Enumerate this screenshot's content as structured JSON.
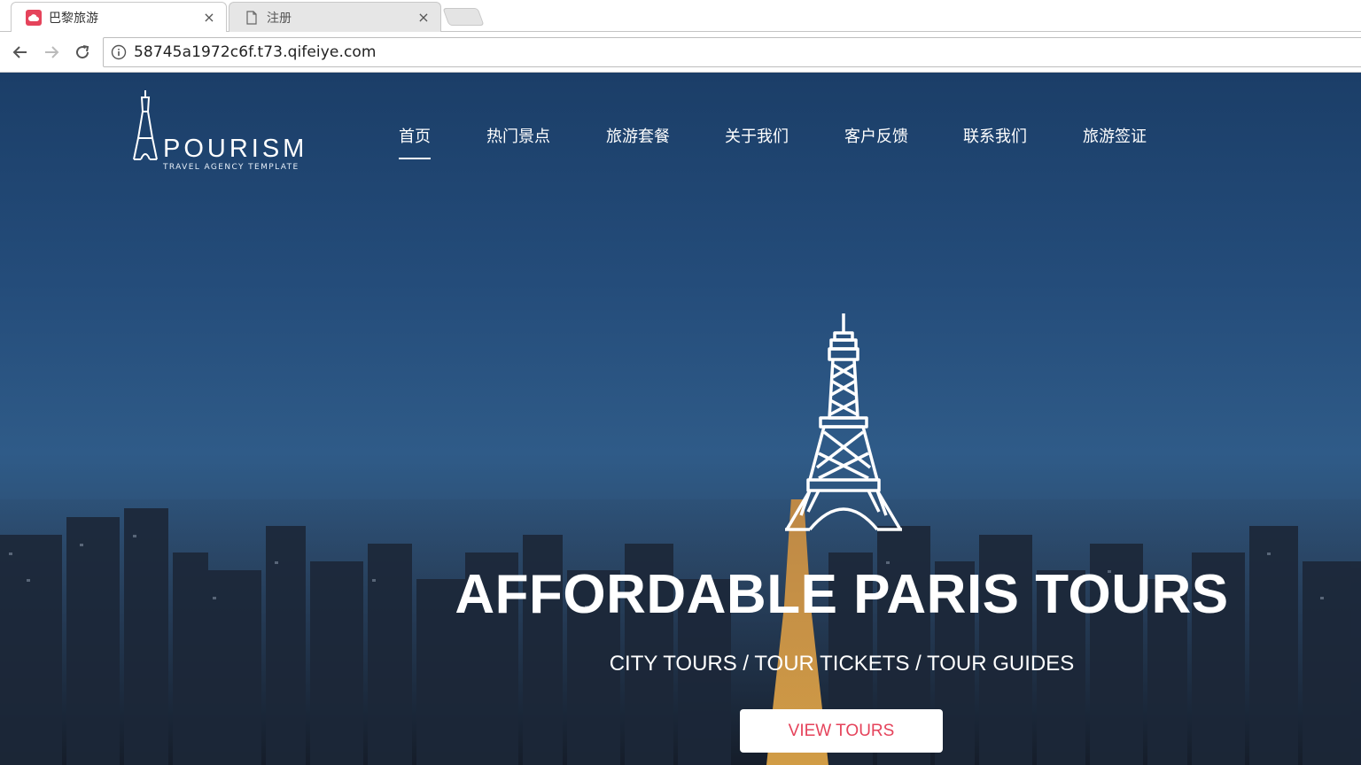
{
  "browser": {
    "tabs": [
      {
        "title": "巴黎旅游",
        "icon": "cloud-favicon-icon",
        "active": true
      },
      {
        "title": "注册",
        "icon": "page-icon",
        "active": false
      }
    ],
    "tab_close_glyph": "×",
    "url": "58745a1972c6f.t73.qifeiye.com"
  },
  "site": {
    "logo": {
      "name": "POURISM",
      "tagline": "TRAVEL AGENCY TEMPLATE"
    },
    "nav": [
      {
        "label": "首页",
        "active": true
      },
      {
        "label": "热门景点",
        "active": false
      },
      {
        "label": "旅游套餐",
        "active": false
      },
      {
        "label": "关于我们",
        "active": false
      },
      {
        "label": "客户反馈",
        "active": false
      },
      {
        "label": "联系我们",
        "active": false
      },
      {
        "label": "旅游签证",
        "active": false
      }
    ],
    "hero": {
      "headline": "AFFORDABLE PARIS TOURS",
      "subline": "CITY TOURS / TOUR TICKETS / TOUR GUIDES",
      "cta_label": "VIEW TOURS"
    }
  },
  "colors": {
    "accent": "#e5435b",
    "hero_top": "#1b3e68",
    "hero_bottom": "#1d2b3e"
  }
}
